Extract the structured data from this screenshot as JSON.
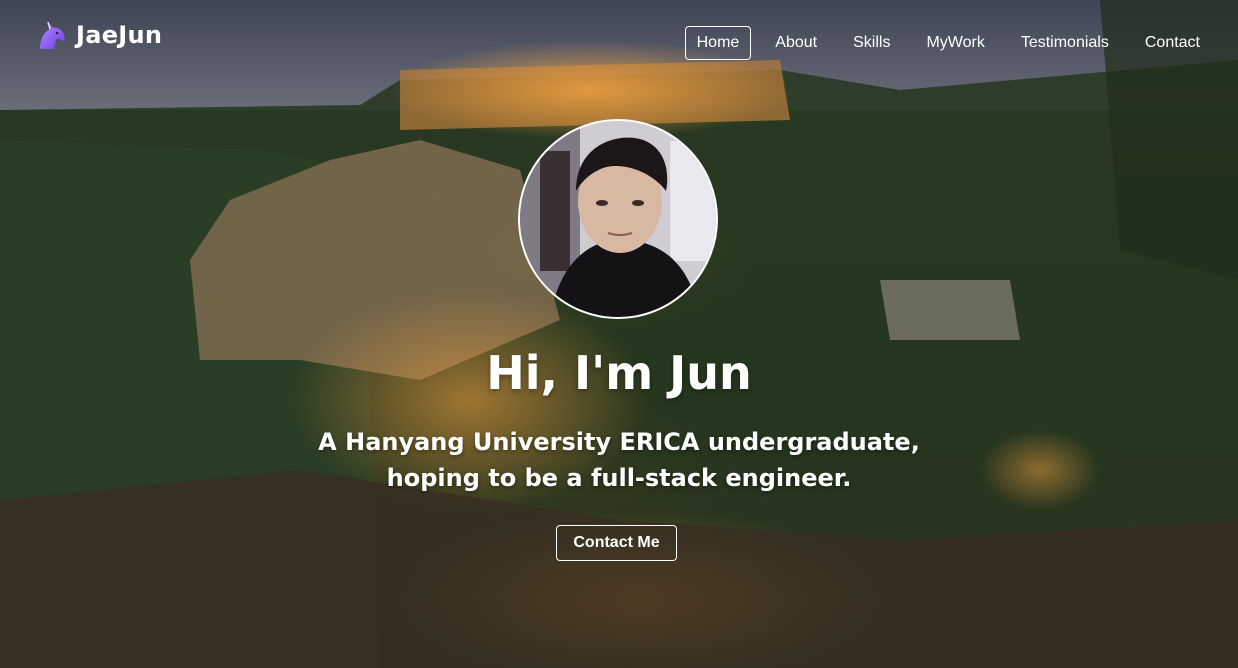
{
  "nav": {
    "brand": "JaeJun",
    "brand_icon": "unicorn-icon",
    "items": [
      {
        "label": "Home",
        "active": true
      },
      {
        "label": "About",
        "active": false
      },
      {
        "label": "Skills",
        "active": false
      },
      {
        "label": "MyWork",
        "active": false
      },
      {
        "label": "Testimonials",
        "active": false
      },
      {
        "label": "Contact",
        "active": false
      }
    ]
  },
  "hero": {
    "title": "Hi, I'm Jun",
    "subtitle_line1": "A Hanyang University ERICA undergraduate,",
    "subtitle_line2": "hoping to be a full-stack engineer.",
    "cta_label": "Contact Me"
  },
  "colors": {
    "text": "#ffffff",
    "logo_accent": "#8a5cf5",
    "cta_border": "#ffffff"
  }
}
